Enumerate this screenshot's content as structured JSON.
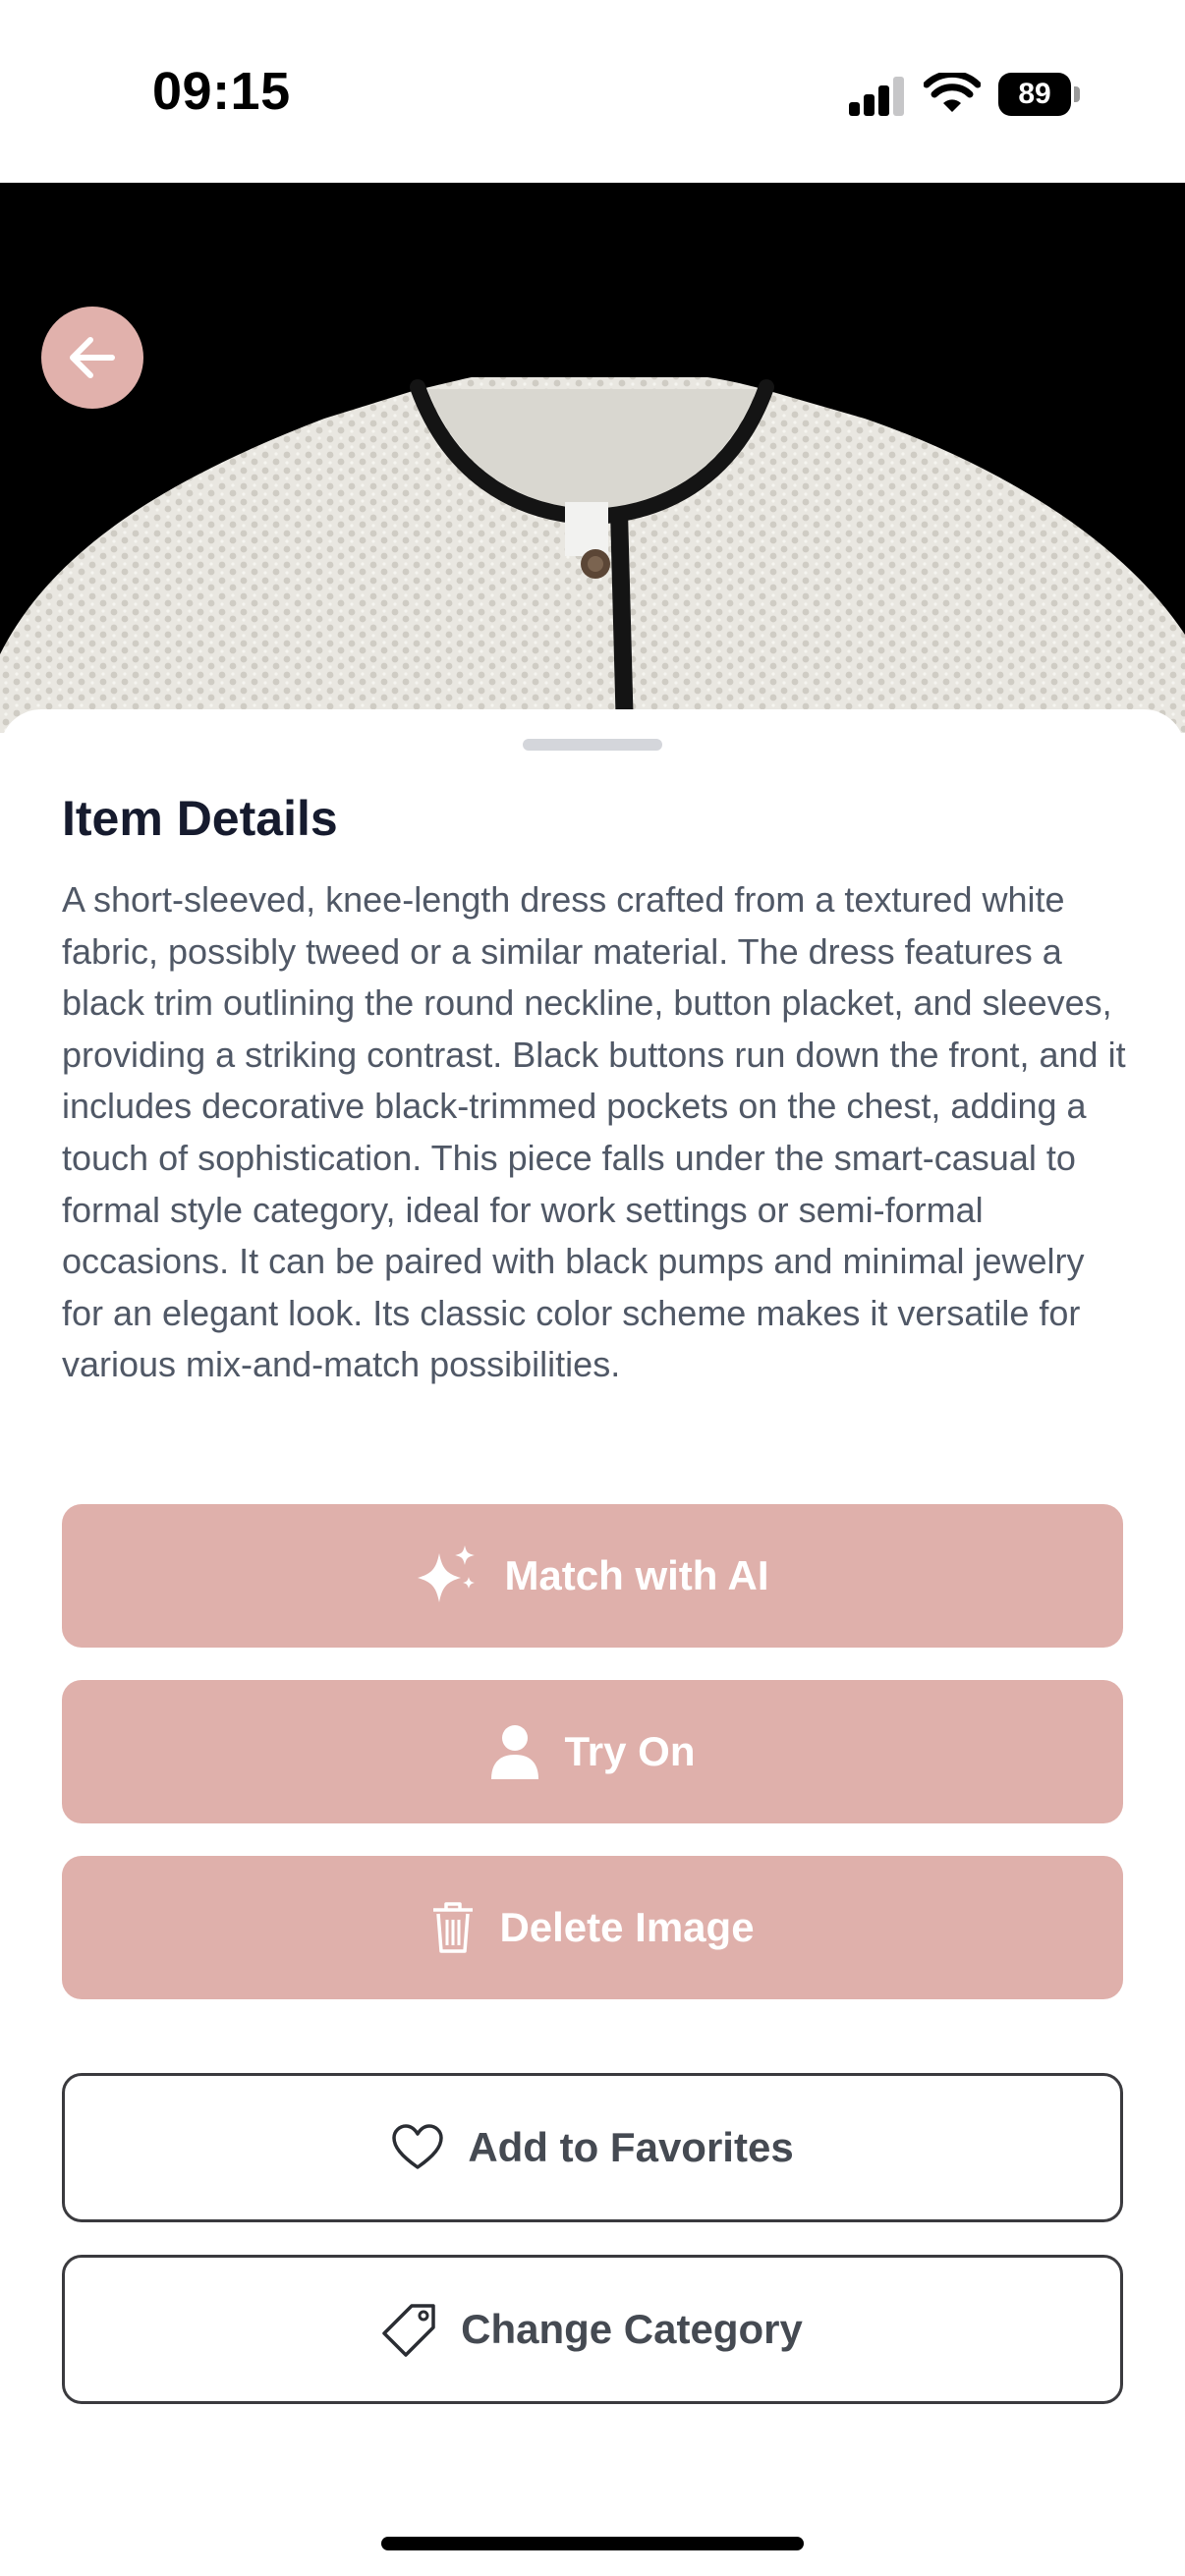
{
  "status_bar": {
    "time": "09:15",
    "battery": "89"
  },
  "hero": {
    "image": "white textured knit garment with black trim on black background"
  },
  "sheet": {
    "title": "Item Details",
    "description": "A short-sleeved, knee-length dress crafted from a textured white fabric, possibly tweed or a similar material. The dress features a black trim outlining the round neckline, button placket, and sleeves, providing a striking contrast. Black buttons run down the front, and it includes decorative black-trimmed pockets on the chest, adding a touch of sophistication. This piece falls under the smart-casual to formal style category, ideal for work settings or semi-formal occasions. It can be paired with black pumps and minimal jewelry for an elegant look. Its classic color scheme makes it versatile for various mix-and-match possibilities."
  },
  "actions": {
    "match_ai": "Match with AI",
    "try_on": "Try On",
    "delete_image": "Delete Image",
    "add_favorites": "Add to Favorites",
    "change_category": "Change Category"
  },
  "icons": {
    "back": "arrow-left-icon",
    "match_ai": "sparkles-icon",
    "try_on": "person-icon",
    "delete_image": "trash-icon",
    "add_favorites": "heart-icon",
    "change_category": "tag-icon"
  },
  "colors": {
    "accent": "#dfb0ab",
    "title": "#161b2e",
    "body_text": "#505866",
    "outline": "#3a3a3e"
  }
}
